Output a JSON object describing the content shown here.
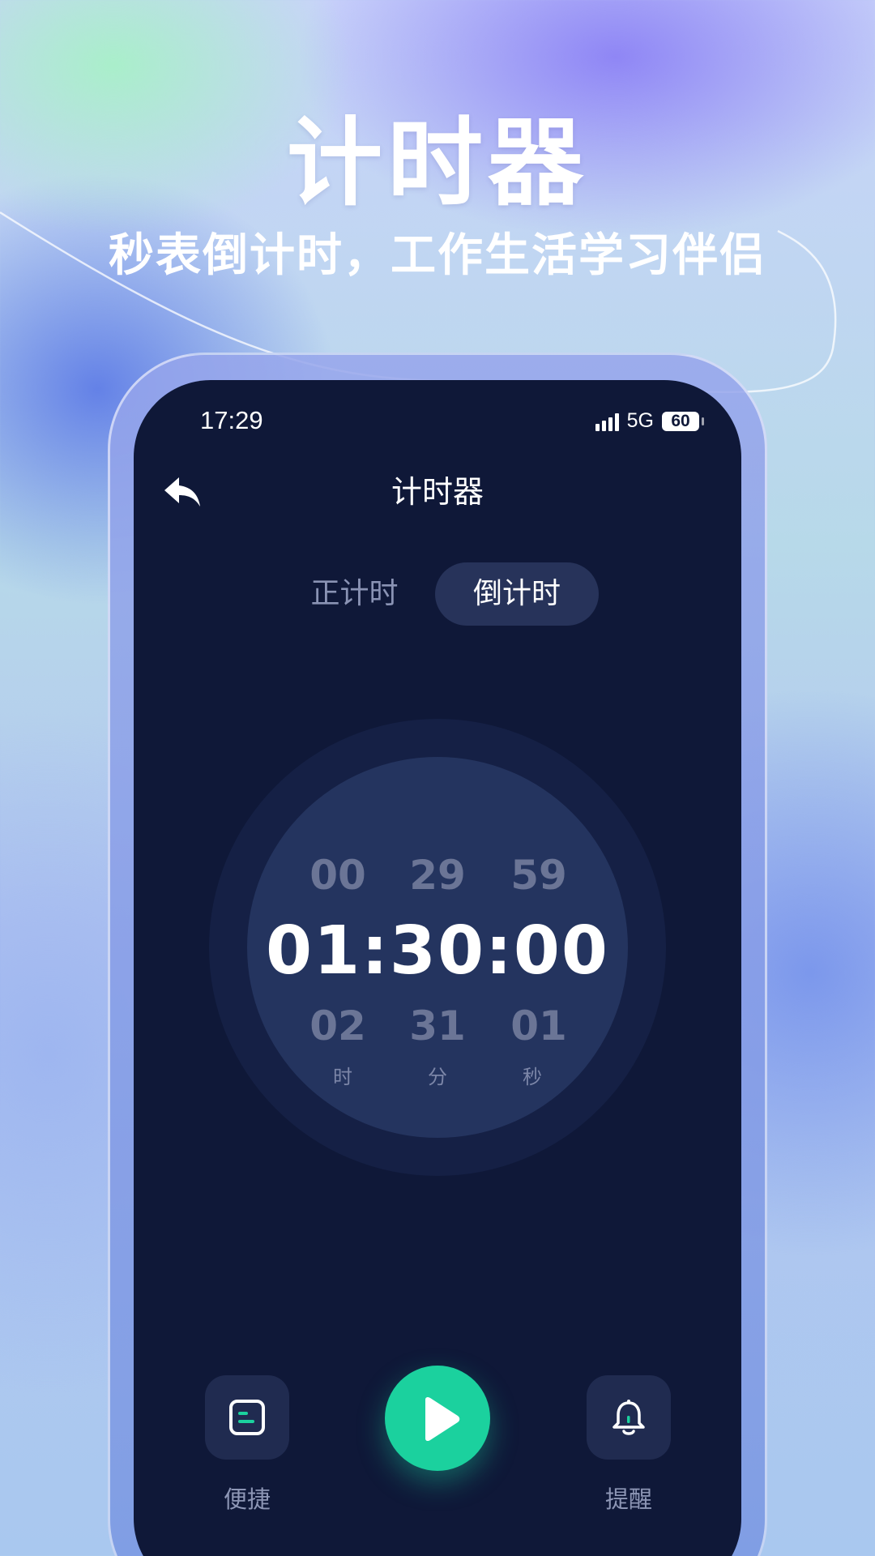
{
  "hero": {
    "title": "计时器",
    "subtitle": "秒表倒计时，工作生活学习伴侣"
  },
  "status_bar": {
    "time": "17:29",
    "network": "5G",
    "battery": "60"
  },
  "nav": {
    "title": "计时器",
    "back_icon": "back-arrow-icon"
  },
  "tabs": [
    {
      "label": "正计时",
      "active": false
    },
    {
      "label": "倒计时",
      "active": true
    }
  ],
  "timer": {
    "prev": {
      "hours": "00",
      "minutes": "29",
      "seconds": "59"
    },
    "current": "01:30:00",
    "next": {
      "hours": "02",
      "minutes": "31",
      "seconds": "01"
    },
    "units": {
      "hours": "时",
      "minutes": "分",
      "seconds": "秒"
    }
  },
  "controls": {
    "shortcut_label": "便捷",
    "remind_label": "提醒",
    "shortcut_icon": "shortcut-list-icon",
    "play_icon": "play-icon",
    "remind_icon": "bell-icon"
  },
  "colors": {
    "screen_bg": "#0f1838",
    "accent": "#1bd19e",
    "tab_active_bg": "#27335a"
  }
}
